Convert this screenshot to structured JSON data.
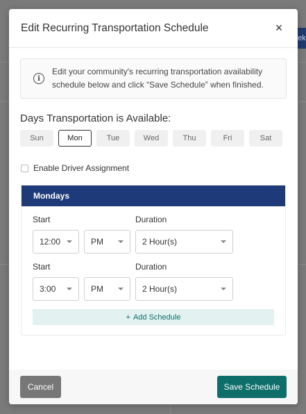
{
  "modal": {
    "title": "Edit Recurring Transportation Schedule",
    "close_icon": "×"
  },
  "info": {
    "text": "Edit your community's recurring transportation availability schedule below and click “Save Schedule” when finished."
  },
  "days": {
    "label": "Days Transportation is Available:",
    "items": [
      {
        "label": "Sun",
        "selected": false
      },
      {
        "label": "Mon",
        "selected": true
      },
      {
        "label": "Tue",
        "selected": false
      },
      {
        "label": "Wed",
        "selected": false
      },
      {
        "label": "Thu",
        "selected": false
      },
      {
        "label": "Fri",
        "selected": false
      },
      {
        "label": "Sat",
        "selected": false
      }
    ]
  },
  "driver": {
    "label": "Enable Driver Assignment",
    "checked": false
  },
  "panel": {
    "title": "Mondays",
    "start_label": "Start",
    "duration_label": "Duration",
    "schedules": [
      {
        "time": "12:00",
        "ampm": "PM",
        "duration": "2 Hour(s)"
      },
      {
        "time": "3:00",
        "ampm": "PM",
        "duration": "2 Hour(s)"
      }
    ],
    "add_label": "Add Schedule"
  },
  "footer": {
    "cancel_label": "Cancel",
    "save_label": "Save Schedule"
  },
  "colors": {
    "panel_header": "#1e3a78",
    "save_button": "#0d6e6a",
    "cancel_button": "#777777"
  }
}
